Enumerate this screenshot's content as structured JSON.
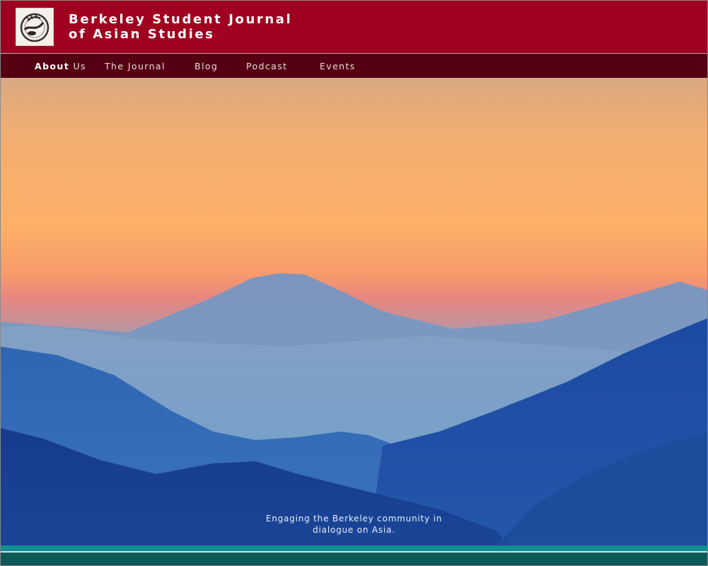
{
  "header": {
    "title_line1": "Berkeley Student Journal",
    "title_line2": "of Asian Studies",
    "logo_icon": "journal-emblem-icon",
    "brand_color": "#a0001f"
  },
  "nav": {
    "items": [
      {
        "label_strong": "About",
        "label": " Us"
      },
      {
        "label": "The Journal"
      },
      {
        "label": "Blog"
      },
      {
        "label": "Podcast"
      },
      {
        "label": "Events"
      }
    ],
    "bg_color": "#550012"
  },
  "hero": {
    "tagline_line1": "Engaging the Berkeley community in",
    "tagline_line2": "dialogue on Asia."
  },
  "footer": {
    "accent_color": "#0f8f8f"
  }
}
